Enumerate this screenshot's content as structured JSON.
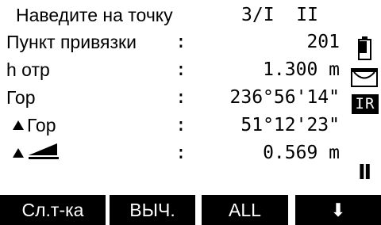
{
  "title": {
    "text": "Наведите на точку",
    "page": "3/I  II"
  },
  "rows": [
    {
      "label": "Пункт привязки",
      "sep": ":",
      "value": "201",
      "icon": ""
    },
    {
      "label": "h отр",
      "sep": ":",
      "value": "1.300 m",
      "icon": ""
    },
    {
      "label": "Гор",
      "sep": ":",
      "value": "236°56'14\"",
      "icon": ""
    },
    {
      "label": "Гор",
      "sep": ":",
      "value": "51°12'23\"",
      "icon": "up-triangle-icon"
    },
    {
      "label": "",
      "sep": ":",
      "value": "0.569 m",
      "icon": "slope-distance-icon"
    }
  ],
  "status": {
    "battery_icon": "battery-icon",
    "level_icon": "level-icon",
    "ir_label": "IR",
    "face_label": "Ⅱ"
  },
  "softkeys": [
    {
      "label": "Сл.т-ка"
    },
    {
      "label": "ВЫЧ."
    },
    {
      "label": "ALL"
    },
    {
      "label": "⬇"
    }
  ],
  "colors": {
    "background": "#ffffff",
    "foreground": "#000000",
    "softkey_bg": "#000000",
    "softkey_text": "#ffffff"
  }
}
